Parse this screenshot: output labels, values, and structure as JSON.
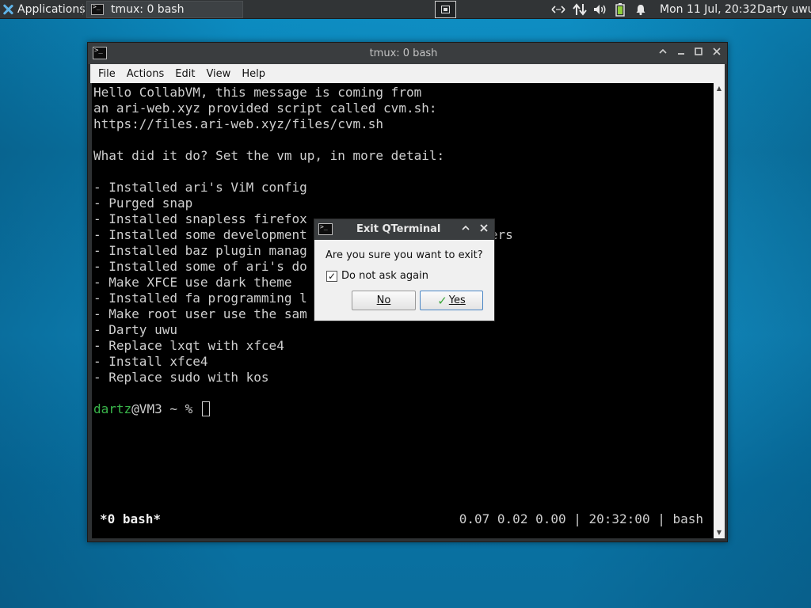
{
  "panel": {
    "applications_label": "Applications",
    "task_label": "tmux: 0 bash",
    "clock": "Mon 11 Jul, 20:32",
    "user": "Darty uwu",
    "tray_icons": [
      "network-arrows-icon",
      "transfer-icon",
      "volume-icon",
      "battery-icon",
      "notification-bell-icon"
    ]
  },
  "window": {
    "title": "tmux: 0 bash",
    "menu": [
      "File",
      "Actions",
      "Edit",
      "View",
      "Help"
    ]
  },
  "terminal": {
    "lines": [
      "Hello CollabVM, this message is coming from",
      "an ari-web.xyz provided script called cvm.sh:",
      "https://files.ari-web.xyz/files/cvm.sh",
      "",
      "What did it do? Set the vm up, in more detail:",
      "",
      "- Installed ari's ViM config",
      "- Purged snap",
      "- Installed snapless firefox",
      "- Installed some development           s and formatters",
      "- Installed baz plugin manag",
      "- Installed some of ari's do",
      "- Make XFCE use dark theme",
      "- Installed fa programming l                  `)",
      "- Make root user use the sam",
      "- Darty uwu",
      "- Replace lxqt with xfce4",
      "- Install xfce4",
      "- Replace sudo with kos"
    ],
    "prompt_user": "dartz",
    "prompt_rest": "@VM3 ~ % ",
    "status_left": "*0 bash*",
    "status_right": "0.07 0.02 0.00 | 20:32:00 | bash"
  },
  "dialog": {
    "title": "Exit QTerminal",
    "message": "Are you sure you want to exit?",
    "checkbox_label": "Do not ask again",
    "checkbox_checked": true,
    "no_label": "No",
    "yes_label": "Yes"
  }
}
